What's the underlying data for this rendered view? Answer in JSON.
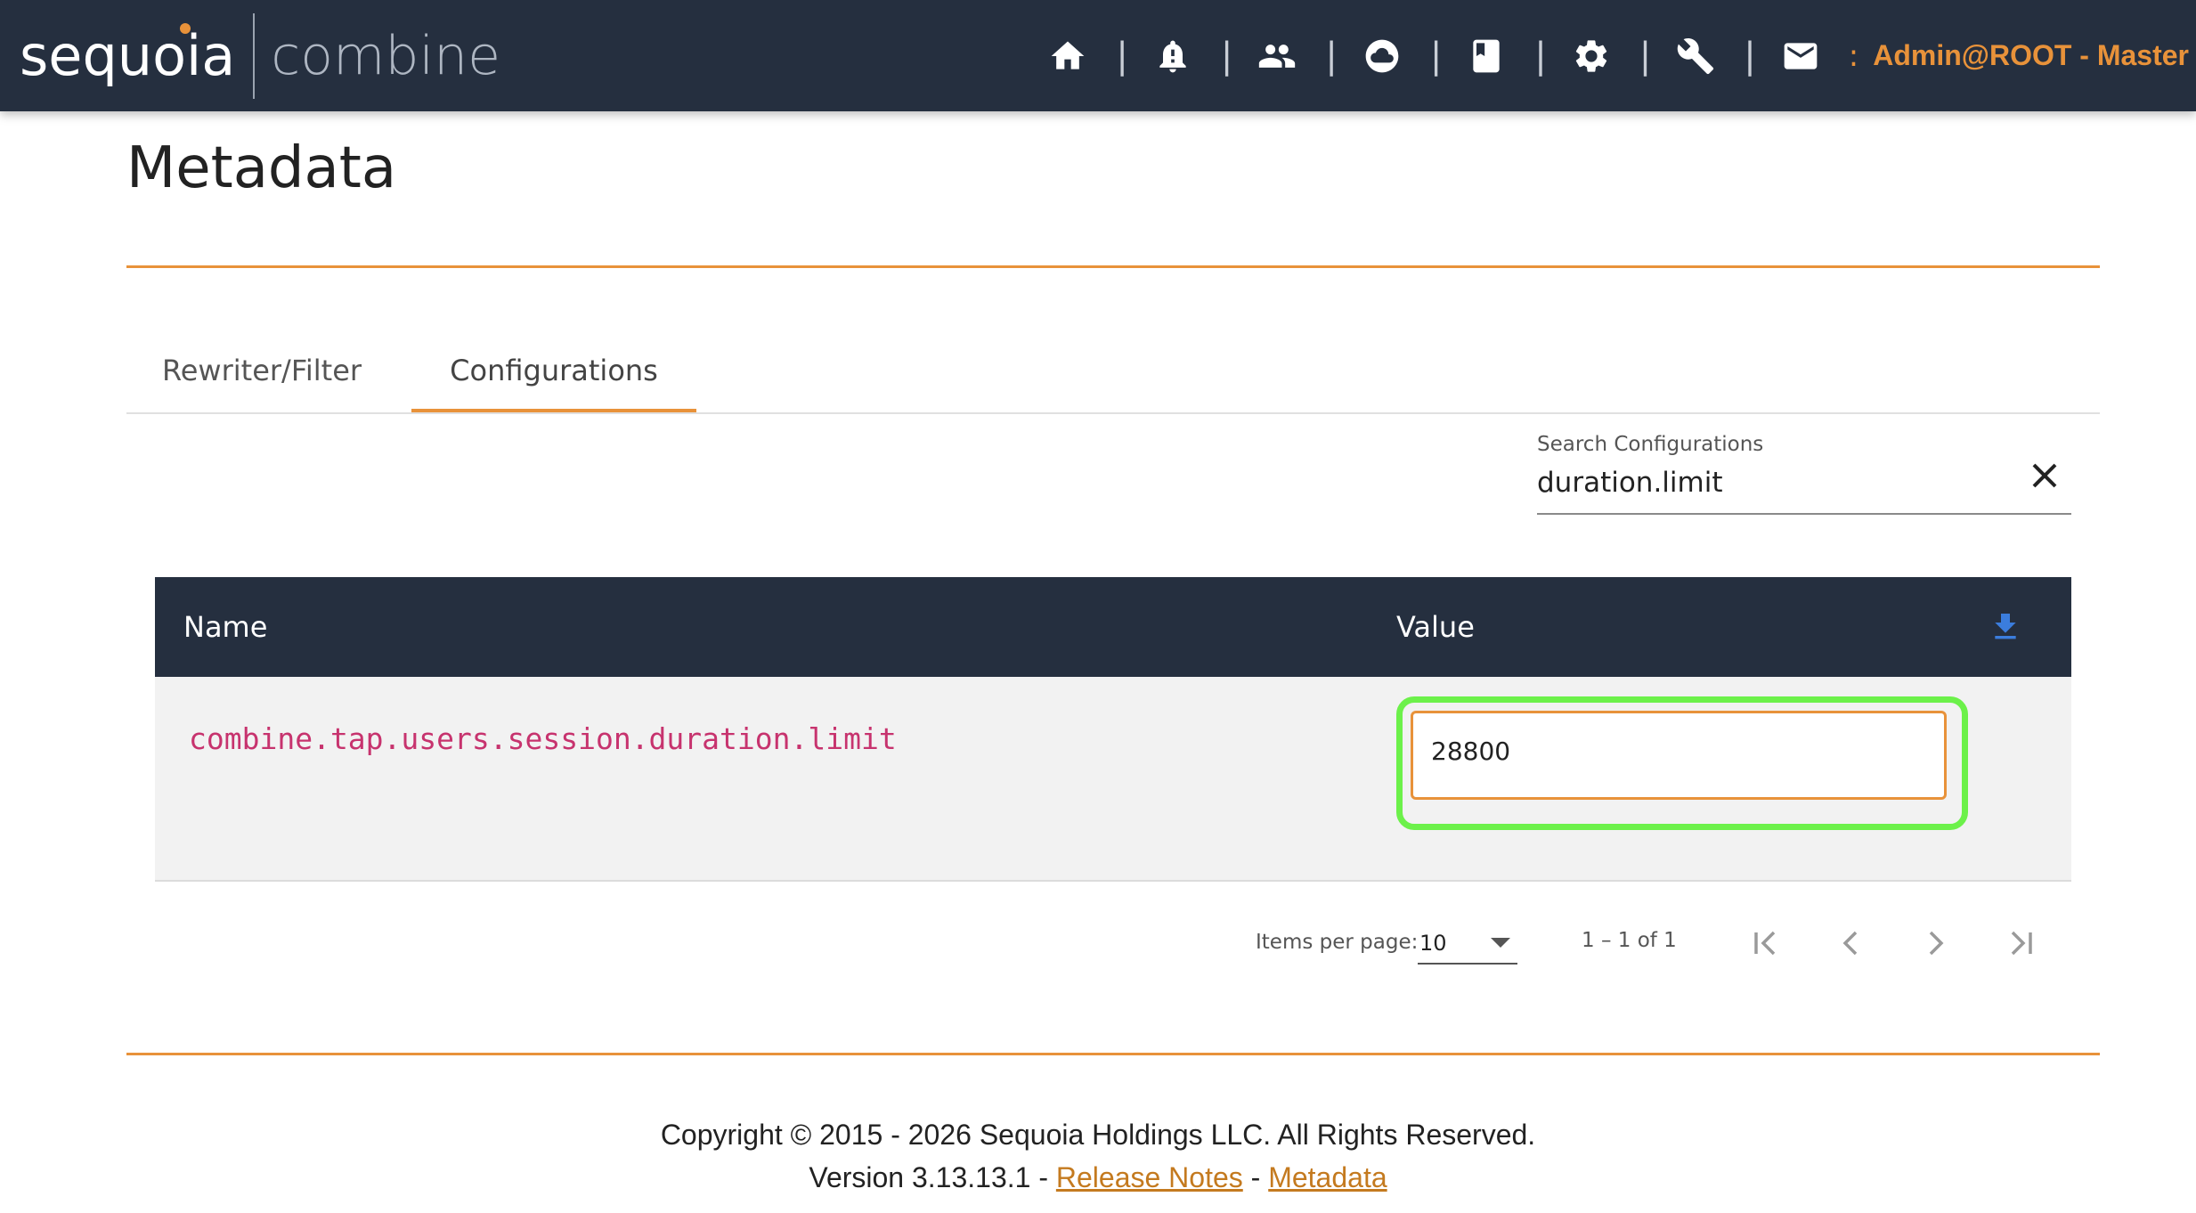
{
  "header": {
    "logo_primary": "sequoia",
    "logo_secondary": "combine",
    "nav_separator": "|",
    "nav_icons": [
      "home-icon",
      "bell-alert-icon",
      "people-icon",
      "cloud-icon",
      "book-icon",
      "gear-icon",
      "wrench-icon",
      "mail-icon"
    ],
    "user_colon": ":",
    "user_label": "Admin@ROOT - Master",
    "accent_color": "#e8923a",
    "bar_color": "#252f3f"
  },
  "page": {
    "title": "Metadata"
  },
  "tabs": [
    {
      "label": "Rewriter/Filter",
      "active": false
    },
    {
      "label": "Configurations",
      "active": true
    }
  ],
  "search": {
    "label": "Search Configurations",
    "value": "duration.limit",
    "clear_icon": "close-icon"
  },
  "table": {
    "columns": [
      "Name",
      "Value"
    ],
    "download_icon": "download-icon",
    "rows": [
      {
        "name": "combine.tap.users.session.duration.limit",
        "value": "28800"
      }
    ],
    "name_color": "#c7336e"
  },
  "paginator": {
    "items_per_page_label": "Items per page:",
    "items_per_page_value": "10",
    "range_label": "1 – 1 of 1"
  },
  "footer": {
    "copyright": "Copyright © 2015 - 2026 Sequoia Holdings LLC. All Rights Reserved.",
    "version_prefix": "Version 3.13.13.1 -",
    "link_separator": "-",
    "release_notes_link": "Release Notes",
    "metadata_link": "Metadata"
  }
}
